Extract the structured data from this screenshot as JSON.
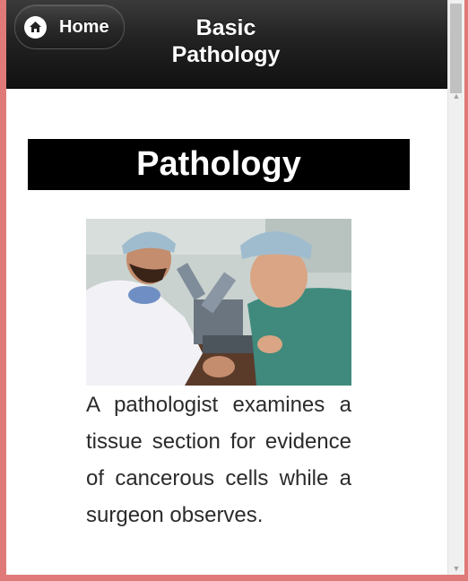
{
  "header": {
    "home_label": "Home",
    "title_line1": "Basic",
    "title_line2": "Pathology"
  },
  "main": {
    "section_title": "Pathology",
    "photo_icon": "pathologist-microscope-photo",
    "caption": "A pathologist examines a tissue section for evidence of cancerous cells while a surgeon observes."
  },
  "colors": {
    "header_bg": "#222222",
    "banner_bg": "#000000",
    "banner_text": "#ffffff",
    "caption_text": "#2b2b2b",
    "window_border": "#e07a78"
  }
}
